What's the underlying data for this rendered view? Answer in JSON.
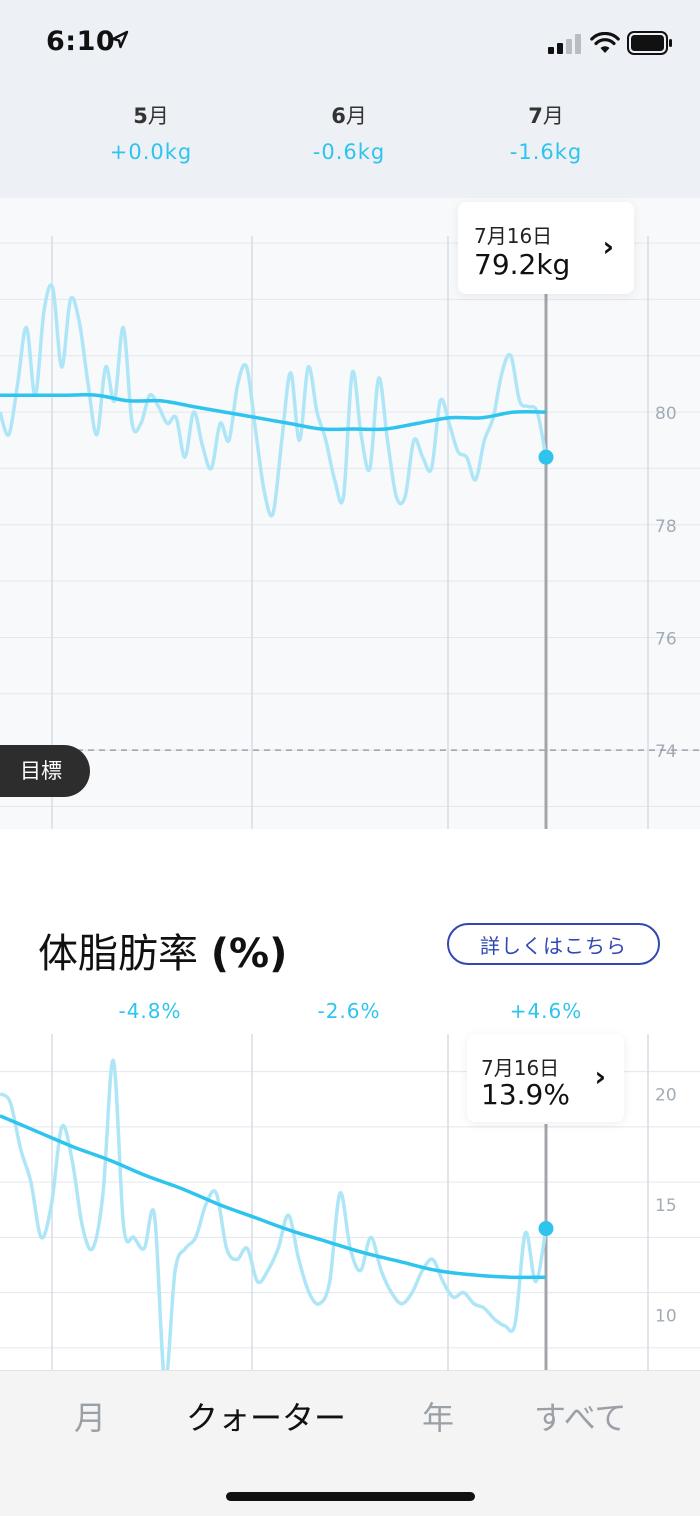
{
  "status": {
    "time": "6:10"
  },
  "months": [
    {
      "name": "5",
      "suffix": "月",
      "delta": "+0.0kg"
    },
    {
      "name": "6",
      "suffix": "月",
      "delta": "-0.6kg"
    },
    {
      "name": "7",
      "suffix": "月",
      "delta": "-1.6kg"
    }
  ],
  "weight": {
    "tooltip": {
      "date": "7月16日",
      "value": "79.2kg"
    },
    "goal_label": "目標"
  },
  "fat": {
    "title": "体脂肪率",
    "title_unit": "(%)",
    "details_button": "詳しくはこちら",
    "deltas": [
      "-4.8%",
      "-2.6%",
      "+4.6%"
    ],
    "tooltip": {
      "date": "7月16日",
      "value": "13.9%"
    }
  },
  "tabs": [
    {
      "label": "月",
      "active": false
    },
    {
      "label": "クォーター",
      "active": true
    },
    {
      "label": "年",
      "active": false
    },
    {
      "label": "すべて",
      "active": false
    }
  ],
  "colors": {
    "accent": "#2ec4ee",
    "raw_line": "#aee6f7",
    "button": "#3048b4"
  },
  "chart_data": [
    {
      "type": "line",
      "title": "",
      "ylabel": "",
      "y_ticks": [
        74,
        76,
        78,
        80
      ],
      "ylim": [
        72.6,
        83.8
      ],
      "goal_value": 74,
      "selected": {
        "label": "7月16日",
        "value": 79.2
      },
      "grid": true,
      "series": [
        {
          "role": "daily",
          "values": [
            80.0,
            79.6,
            80.5,
            81.5,
            80.3,
            81.8,
            82.2,
            80.8,
            82.0,
            81.6,
            80.5,
            79.6,
            80.8,
            80.2,
            81.5,
            79.8,
            79.8,
            80.3,
            80.1,
            79.8,
            79.9,
            79.2,
            80.0,
            79.4,
            79.0,
            79.8,
            79.5,
            80.5,
            80.8,
            79.7,
            78.6,
            78.2,
            79.5,
            80.7,
            79.5,
            80.8,
            80.0,
            79.5,
            78.8,
            78.5,
            80.7,
            79.6,
            79.0,
            80.6,
            79.5,
            78.5,
            78.5,
            79.5,
            79.2,
            79.0,
            80.2,
            79.8,
            79.3,
            79.2,
            78.8,
            79.5,
            79.9,
            80.7,
            81.0,
            80.2,
            80.1,
            80.0,
            79.2
          ]
        },
        {
          "role": "trend",
          "values": [
            80.3,
            80.3,
            80.3,
            80.3,
            80.2,
            80.2,
            80.1,
            80.0,
            79.9,
            79.8,
            79.7,
            79.7,
            79.7,
            79.8,
            79.9,
            79.9,
            80.0,
            80.0
          ]
        }
      ]
    },
    {
      "type": "line",
      "title": "",
      "ylabel": "",
      "y_ticks": [
        10,
        15,
        20
      ],
      "ylim": [
        7.5,
        22.7
      ],
      "selected": {
        "label": "7月16日",
        "value": 13.9
      },
      "grid": true,
      "series": [
        {
          "role": "daily",
          "values": [
            20.0,
            19.6,
            17.5,
            16.0,
            13.5,
            15.0,
            18.5,
            17.0,
            14.0,
            13.0,
            15.5,
            21.5,
            14.0,
            13.5,
            13.0,
            14.5,
            7.0,
            12.0,
            13.0,
            13.5,
            15.0,
            15.5,
            13.0,
            12.5,
            13.0,
            11.5,
            12.0,
            13.0,
            14.5,
            12.5,
            11.0,
            10.5,
            11.5,
            15.5,
            13.0,
            12.0,
            13.5,
            12.0,
            11.0,
            10.5,
            11.0,
            12.0,
            12.5,
            11.5,
            10.8,
            11.0,
            10.5,
            10.3,
            9.8,
            9.5,
            9.6,
            13.7,
            11.5,
            13.9
          ]
        },
        {
          "role": "trend",
          "values": [
            19.0,
            18.3,
            17.6,
            17.0,
            16.3,
            15.7,
            15.0,
            14.4,
            13.8,
            13.3,
            12.8,
            12.4,
            12.0,
            11.8,
            11.7,
            11.7
          ]
        }
      ]
    }
  ]
}
